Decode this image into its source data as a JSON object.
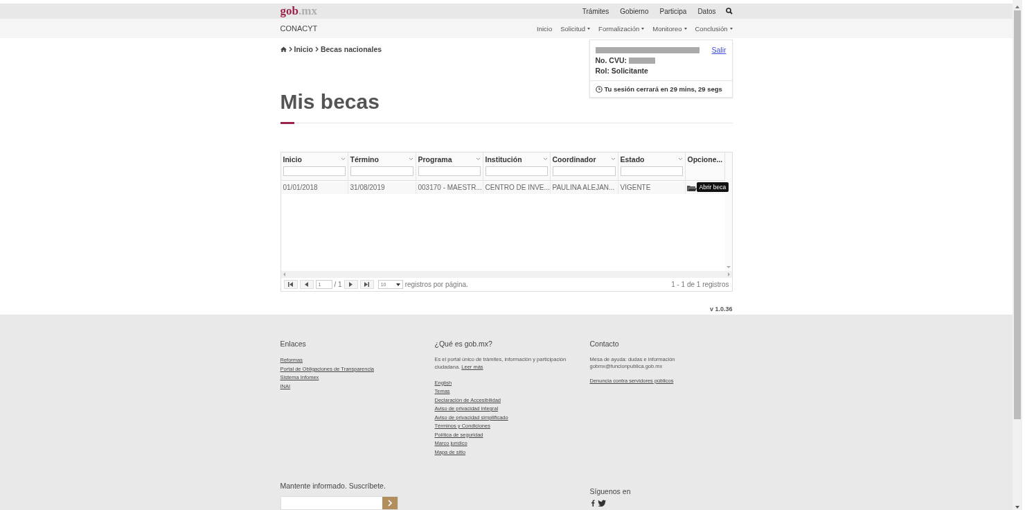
{
  "top_bar": {
    "logo_main": "gob",
    "logo_suffix": ".mx",
    "links": [
      "Trámites",
      "Gobierno",
      "Participa",
      "Datos"
    ]
  },
  "nav": {
    "brand": "CONACYT",
    "items": [
      {
        "label": "Inicio",
        "dropdown": false
      },
      {
        "label": "Solicitud",
        "dropdown": true
      },
      {
        "label": "Formalización",
        "dropdown": true
      },
      {
        "label": "Monitoreo",
        "dropdown": true
      },
      {
        "label": "Conclusión",
        "dropdown": true
      }
    ]
  },
  "breadcrumb": [
    "Inicio",
    "Becas nacionales"
  ],
  "session": {
    "logout": "Salir",
    "cvu_label": "No. CVU:",
    "role": "Rol: Solicitante",
    "timer": "Tu sesión cerrará en 29 mins, 29 segs"
  },
  "title": "Mis becas",
  "table": {
    "columns": [
      "Inicio",
      "Término",
      "Programa",
      "Institución",
      "Coordinador",
      "Estado",
      "Opcione..."
    ],
    "rows": [
      {
        "cells": [
          "01/01/2018",
          "31/08/2019",
          "003170 - MAESTR...",
          "CENTRO DE INVE...",
          "PAULINA ALEJAN...",
          "VIGENTE"
        ],
        "tooltip": "Abrir beca"
      }
    ]
  },
  "pager": {
    "page": "1",
    "total": "/ 1",
    "page_size": "10",
    "per_page_label": "registros por página.",
    "summary": "1 - 1 de 1 registros"
  },
  "version": "v 1.0.36",
  "footer": {
    "columns": [
      {
        "title": "Enlaces",
        "links": [
          "Reformas",
          "Portal de Obligaciones de Transparencia",
          "Sistema Infomex",
          "INAI"
        ]
      },
      {
        "title": "¿Qué es gob.mx?",
        "text": "Es el portal único de trámites, información y participación ciudadana.",
        "more": "Leer más",
        "links": [
          "English",
          "Temas",
          "Declaración de Accesibilidad",
          "Aviso de privacidad integral",
          "Aviso de privacidad simplificado",
          "Términos y Condiciones",
          "Política de seguridad",
          "Marco jurídico",
          "Mapa de sitio"
        ]
      },
      {
        "title": "Contacto",
        "lines": [
          "Mesa de ayuda: dudas e información",
          "gobmx@funcionpublica.gob.mx"
        ],
        "links": [
          "Denuncia contra servidores públicos"
        ]
      }
    ],
    "subscribe": "Mantente informado. Suscríbete.",
    "follow": "Síguenos en"
  }
}
